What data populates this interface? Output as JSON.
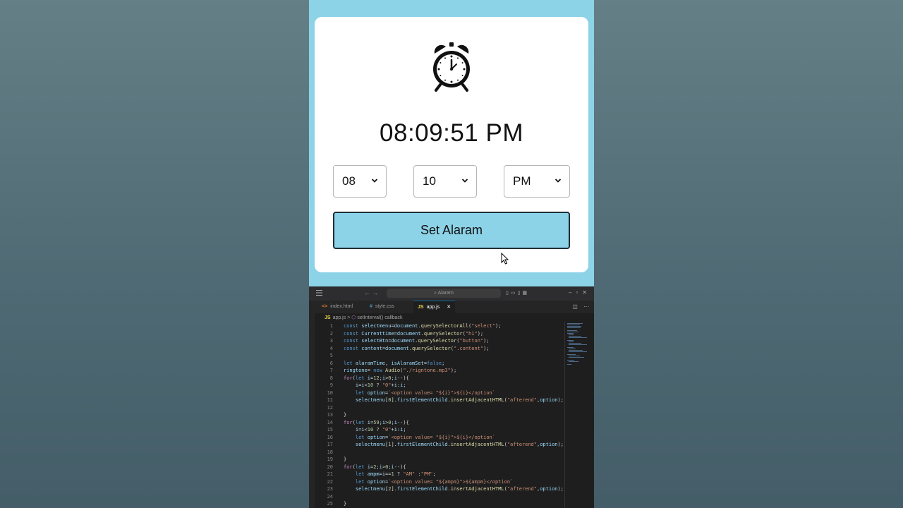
{
  "app": {
    "time_display": "08:09:51 PM",
    "selects": [
      {
        "value": "08"
      },
      {
        "value": "10"
      },
      {
        "value": "PM"
      }
    ],
    "set_button_label": "Set Alaram",
    "icon": "alarm-clock-icon"
  },
  "editor": {
    "search_text": "Alaram",
    "tabs": [
      {
        "icon": "<>",
        "label": "index.html"
      },
      {
        "icon": "#",
        "label": "style.css"
      },
      {
        "icon": "JS",
        "label": "app.js",
        "close": "✕"
      }
    ],
    "breadcrumb": {
      "icon": "JS",
      "file": "app.js",
      "separator": ">",
      "symbol": "setInterval() callback"
    },
    "code_lines": [
      {
        "n": "1",
        "text": "const selectmenu=document.querySelectorAll(\"select\");"
      },
      {
        "n": "2",
        "text": "const Currenttime=document.querySelector(\"h1\");"
      },
      {
        "n": "3",
        "text": "const selectBtn=document.querySelector(\"button\");"
      },
      {
        "n": "4",
        "text": "const content=document.querySelector(\".content\");"
      },
      {
        "n": "5",
        "text": ""
      },
      {
        "n": "6",
        "text": "let alaramTime, isAlaramSet=false;"
      },
      {
        "n": "7",
        "text": "ringtone= new Audio(\"./rigntone.mp3\");"
      },
      {
        "n": "8",
        "text": "for(let i=12;i>0;i--){"
      },
      {
        "n": "9",
        "text": "    i=i<10 ? \"0\"+i:i;"
      },
      {
        "n": "10",
        "text": "    let option=`<option value= \"${i}\">${i}</option`"
      },
      {
        "n": "11",
        "text": "    selectmenu[0].firstElementChild.insertAdjacentHTML(\"afterend\",option);"
      },
      {
        "n": "12",
        "text": ""
      },
      {
        "n": "13",
        "text": "}"
      },
      {
        "n": "14",
        "text": "for(let i=59;i>0;i--){"
      },
      {
        "n": "15",
        "text": "    i=i<10 ? \"0\"+i:i;"
      },
      {
        "n": "16",
        "text": "    let option=`<option value= \"${i}\">${i}</option`"
      },
      {
        "n": "17",
        "text": "    selectmenu[1].firstElementChild.insertAdjacentHTML(\"afterend\",option);"
      },
      {
        "n": "18",
        "text": ""
      },
      {
        "n": "19",
        "text": "}"
      },
      {
        "n": "20",
        "text": "for(let i=2;i>0;i--){"
      },
      {
        "n": "21",
        "text": "    let ampm=i==1 ? \"AM\" :\"PM\";"
      },
      {
        "n": "22",
        "text": "    let option=`<option value= \"${ampm}\">${ampm}</option`"
      },
      {
        "n": "23",
        "text": "    selectmenu[2].firstElementChild.insertAdjacentHTML(\"afterend\",option);"
      },
      {
        "n": "24",
        "text": ""
      },
      {
        "n": "25",
        "text": "}"
      }
    ]
  },
  "colors": {
    "preview_bg": "#8dd3e8",
    "button_bg": "#8dd3e8",
    "editor_bg": "#1e1e1e",
    "page_bg": "#5b747c"
  }
}
